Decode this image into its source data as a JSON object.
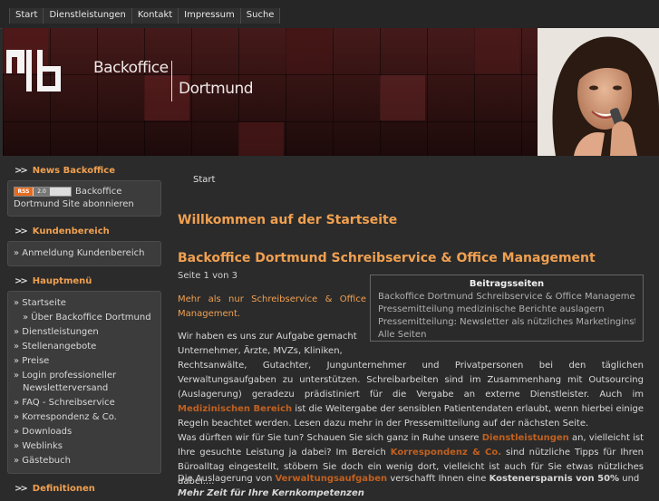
{
  "nav": [
    "Start",
    "Dienstleistungen",
    "Kontakt",
    "Impressum",
    "Suche"
  ],
  "banner": {
    "line1": "Backoffice",
    "line2": "Dortmund"
  },
  "sidebar": {
    "news_title": "News Backoffice",
    "rss_label": "RSS",
    "rss_version": "2.0",
    "rss_text": "Backoffice Dortmund Site abonnieren",
    "kunden_title": "Kundenbereich",
    "kunden_items": [
      "» Anmeldung Kundenbereich"
    ],
    "haupt_title": "Hauptmenü",
    "haupt_items": [
      "» Startseite",
      "» Über Backoffice Dortmund",
      "» Dienstleistungen",
      "» Stellenangebote",
      "» Preise",
      "» Login professioneller",
      "Newsletterversand",
      "» FAQ - Schreibservice",
      "» Korrespondenz & Co.",
      "» Downloads",
      "» Weblinks",
      "» Gästebuch"
    ],
    "def_title": "Definitionen"
  },
  "main": {
    "breadcrumb": "Start",
    "welcome": "Willkommen auf der Startseite",
    "article_title": "Backoffice Dortmund Schreibservice & Office Management",
    "pages": "Seite 1 von 3",
    "intro": "Mehr als nur Schreibservice & Office Management.",
    "body1": "Wir haben es uns zur Aufgabe gemacht",
    "body2": "Unternehmer, Ärzte, MVZs, Kliniken,",
    "body3": "Rechtsanwälte, Gutachter, Jungunternehmer und Privatpersonen bei den täglichen Verwaltungsaufgaben zu unterstützen. Schreibarbeiten sind im Zusammenhang mit Outsourcing (Auslagerung) geradezu prädistiniert für die Vergabe an externe Dienstleister. Auch im",
    "link_med": "Medizinischen Bereich",
    "body4": "ist die Weitergabe der sensiblen Patientendaten erlaubt, wenn hierbei einige Regeln beachtet werden. Lesen dazu mehr in der Pressemitteilung auf der nächsten Seite.",
    "body5": "Was dürften wir für Sie tun? Schauen Sie sich ganz in Ruhe unsere",
    "link_dienst": "Dienstleistungen",
    "body6": "an, vielleicht ist Ihre gesuchte Leistung ja dabei? Im Bereich",
    "link_korr": "Korrespondenz & Co.",
    "body7": "sind nützliche Tipps für Ihren Büroalltag eingestellt, stöbern Sie doch ein wenig dort, vielleicht ist auch für Sie etwas nützliches dabei....",
    "last1": "Die Auslagerung von",
    "link_verw": "Verwaltungsaufgaben",
    "last2": "verschafft Ihnen eine",
    "last3": "Kostenersparnis von 50%",
    "last4": "und",
    "last5": "Mehr Zeit für Ihre Kernkompetenzen"
  },
  "summary": {
    "title": "Beitragsseiten",
    "items": [
      "Backoffice Dortmund Schreibservice & Office Management",
      "Pressemitteilung medizinische Berichte auslagern",
      "Pressemitteilung: Newsletter als nützliches Marketinginstrument",
      "Alle Seiten"
    ]
  },
  "colors": {
    "accent": "#f0a050",
    "link": "#c06020",
    "bg": "#2b2b2b"
  }
}
